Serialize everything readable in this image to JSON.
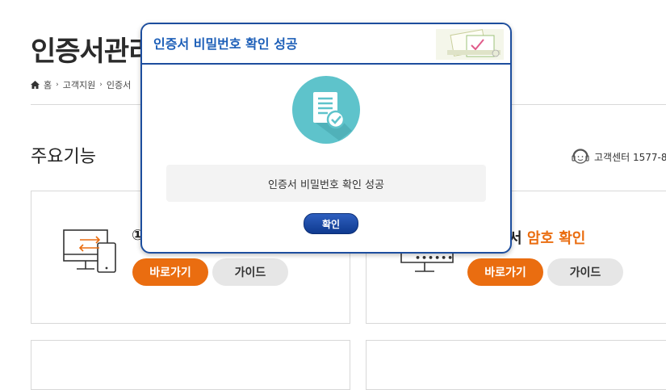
{
  "page": {
    "title": "인증서관리",
    "breadcrumb": [
      "홈",
      "고객지원",
      "인증서"
    ],
    "section_title": "주요기능",
    "support": "고객센터 1577-8"
  },
  "cards": [
    {
      "title_prefix": "①",
      "go_label": "바로가기",
      "guide_label": "가이드"
    },
    {
      "title_plain": "서 ",
      "title_accent": "암호 확인",
      "go_label": "바로가기",
      "guide_label": "가이드",
      "password_mask": "••••••"
    }
  ],
  "modal": {
    "title": "인증서 비밀번호 확인 성공",
    "message": "인증서 비밀번호 확인 성공",
    "confirm_label": "확인"
  },
  "colors": {
    "accent": "#ea6d10",
    "modal_border": "#1d4e9e",
    "modal_title": "#1d5fb8",
    "icon_circle": "#5ec3cb"
  }
}
